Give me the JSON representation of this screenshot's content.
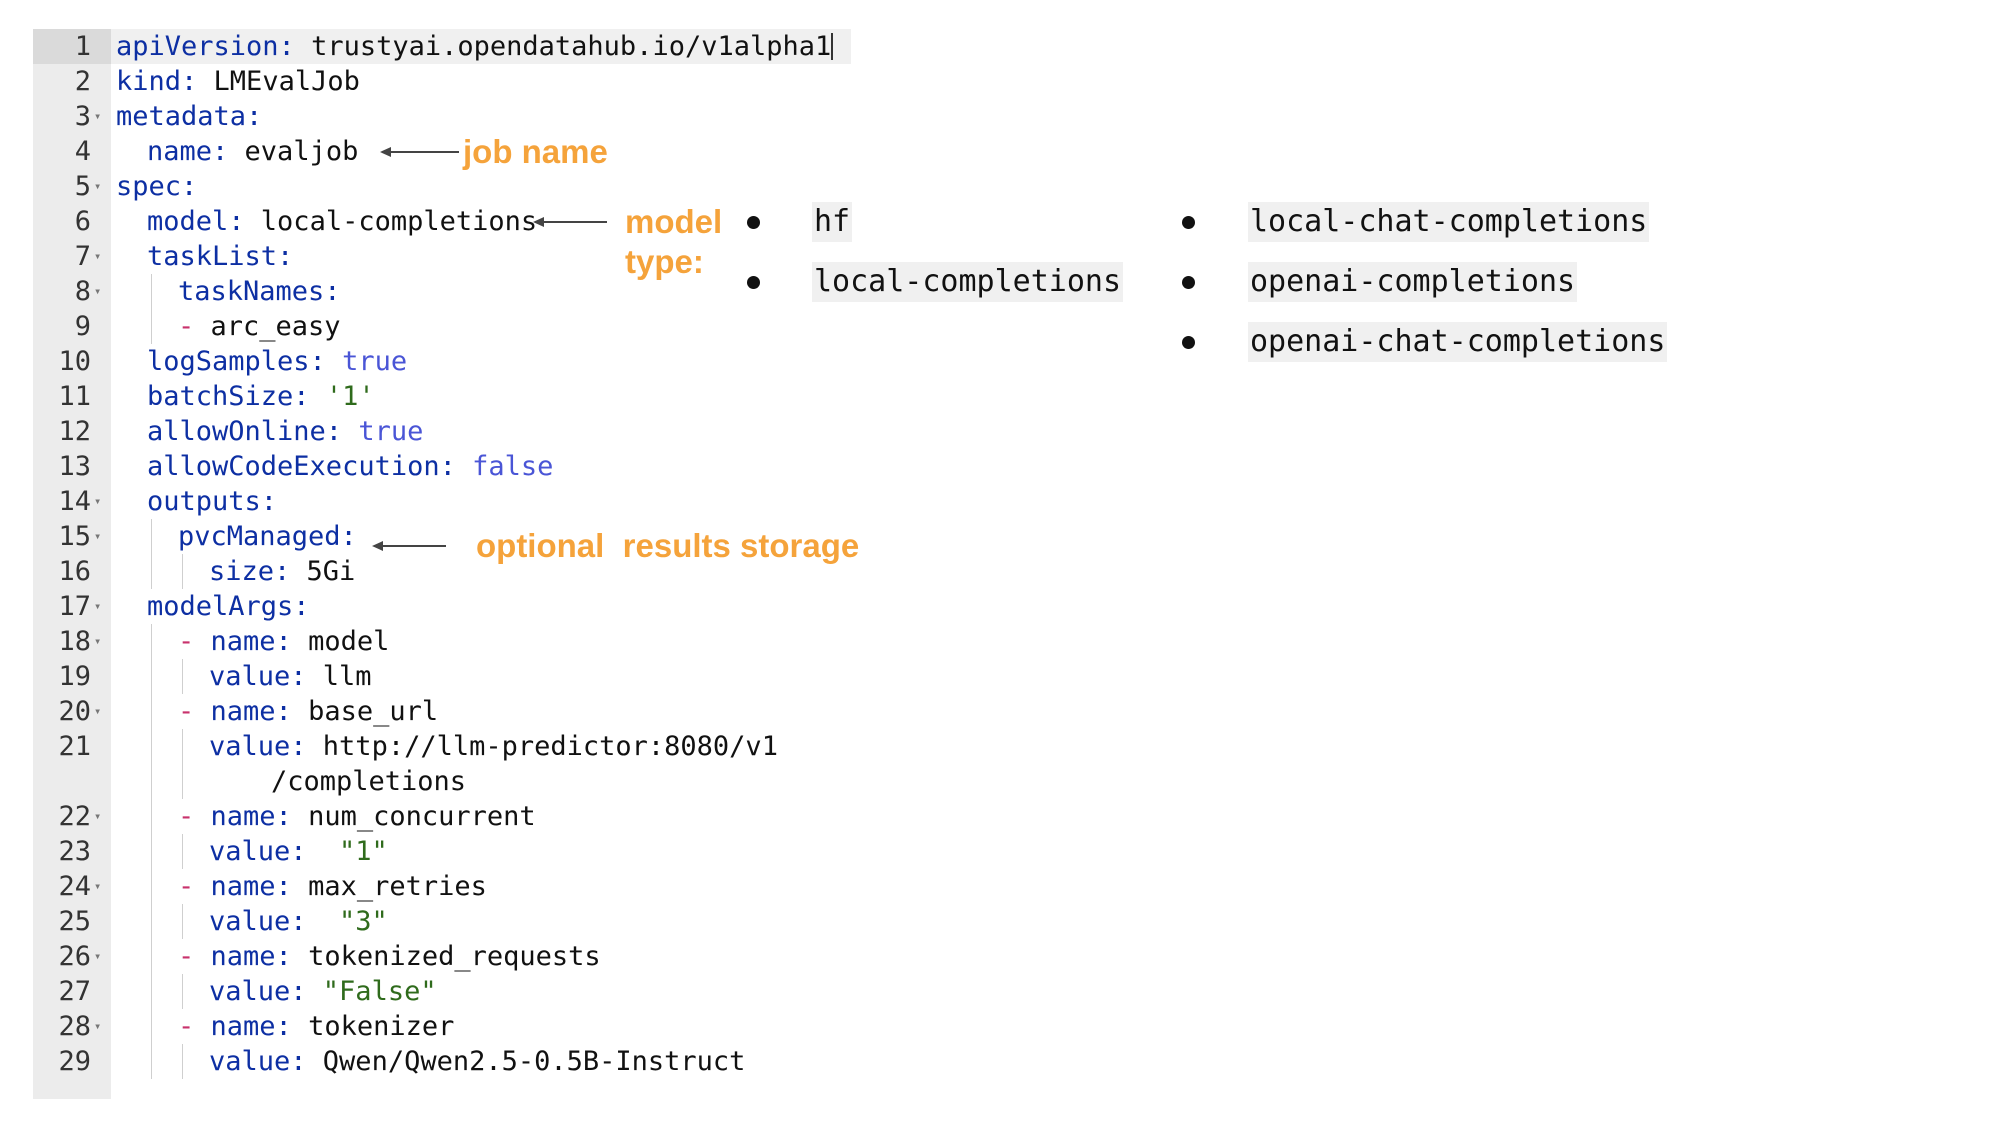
{
  "editor": {
    "lines": [
      {
        "n": "1",
        "fold": false,
        "indent": 0,
        "tokens": [
          [
            "k",
            "apiVersion: "
          ],
          [
            "v",
            "trustyai.opendatahub.io/v1alpha1"
          ]
        ]
      },
      {
        "n": "2",
        "fold": false,
        "indent": 0,
        "tokens": [
          [
            "k",
            "kind: "
          ],
          [
            "v",
            "LMEvalJob"
          ]
        ]
      },
      {
        "n": "3",
        "fold": true,
        "indent": 0,
        "tokens": [
          [
            "k",
            "metadata:"
          ]
        ]
      },
      {
        "n": "4",
        "fold": false,
        "indent": 1,
        "tokens": [
          [
            "k",
            "name: "
          ],
          [
            "v",
            "evaljob"
          ]
        ]
      },
      {
        "n": "5",
        "fold": true,
        "indent": 0,
        "tokens": [
          [
            "k",
            "spec:"
          ]
        ]
      },
      {
        "n": "6",
        "fold": false,
        "indent": 1,
        "tokens": [
          [
            "k",
            "model: "
          ],
          [
            "v",
            "local-completions"
          ]
        ]
      },
      {
        "n": "7",
        "fold": true,
        "indent": 1,
        "tokens": [
          [
            "k",
            "taskList:"
          ]
        ]
      },
      {
        "n": "8",
        "fold": true,
        "indent": 2,
        "tokens": [
          [
            "k",
            "taskNames:"
          ]
        ]
      },
      {
        "n": "9",
        "fold": false,
        "indent": 2,
        "tokens": [
          [
            "d",
            "- "
          ],
          [
            "v",
            "arc_easy"
          ]
        ]
      },
      {
        "n": "10",
        "fold": false,
        "indent": 1,
        "tokens": [
          [
            "k",
            "logSamples: "
          ],
          [
            "b",
            "true"
          ]
        ]
      },
      {
        "n": "11",
        "fold": false,
        "indent": 1,
        "tokens": [
          [
            "k",
            "batchSize: "
          ],
          [
            "s",
            "'1'"
          ]
        ]
      },
      {
        "n": "12",
        "fold": false,
        "indent": 1,
        "tokens": [
          [
            "k",
            "allowOnline: "
          ],
          [
            "b",
            "true"
          ]
        ]
      },
      {
        "n": "13",
        "fold": false,
        "indent": 1,
        "tokens": [
          [
            "k",
            "allowCodeExecution: "
          ],
          [
            "b",
            "false"
          ]
        ]
      },
      {
        "n": "14",
        "fold": true,
        "indent": 1,
        "tokens": [
          [
            "k",
            "outputs:"
          ]
        ]
      },
      {
        "n": "15",
        "fold": true,
        "indent": 2,
        "tokens": [
          [
            "k",
            "pvcManaged:"
          ]
        ]
      },
      {
        "n": "16",
        "fold": false,
        "indent": 3,
        "tokens": [
          [
            "k",
            "size: "
          ],
          [
            "v",
            "5Gi"
          ]
        ]
      },
      {
        "n": "17",
        "fold": true,
        "indent": 1,
        "tokens": [
          [
            "k",
            "modelArgs:"
          ]
        ]
      },
      {
        "n": "18",
        "fold": true,
        "indent": 2,
        "tokens": [
          [
            "d",
            "- "
          ],
          [
            "k",
            "name: "
          ],
          [
            "v",
            "model"
          ]
        ]
      },
      {
        "n": "19",
        "fold": false,
        "indent": 3,
        "tokens": [
          [
            "k",
            "value: "
          ],
          [
            "v",
            "llm"
          ]
        ]
      },
      {
        "n": "20",
        "fold": true,
        "indent": 2,
        "tokens": [
          [
            "d",
            "- "
          ],
          [
            "k",
            "name: "
          ],
          [
            "v",
            "base_url"
          ]
        ]
      },
      {
        "n": "21",
        "fold": false,
        "indent": 3,
        "tokens": [
          [
            "k",
            "value: "
          ],
          [
            "v",
            "http://llm-predictor:8080/v1"
          ]
        ]
      },
      {
        "n": "",
        "fold": false,
        "indent": 5,
        "tokens": [
          [
            "v",
            "/completions"
          ]
        ]
      },
      {
        "n": "22",
        "fold": true,
        "indent": 2,
        "tokens": [
          [
            "d",
            "- "
          ],
          [
            "k",
            "name: "
          ],
          [
            "v",
            "num_concurrent"
          ]
        ]
      },
      {
        "n": "23",
        "fold": false,
        "indent": 3,
        "tokens": [
          [
            "k",
            "value:  "
          ],
          [
            "s",
            "\"1\""
          ]
        ]
      },
      {
        "n": "24",
        "fold": true,
        "indent": 2,
        "tokens": [
          [
            "d",
            "- "
          ],
          [
            "k",
            "name: "
          ],
          [
            "v",
            "max_retries"
          ]
        ]
      },
      {
        "n": "25",
        "fold": false,
        "indent": 3,
        "tokens": [
          [
            "k",
            "value:  "
          ],
          [
            "s",
            "\"3\""
          ]
        ]
      },
      {
        "n": "26",
        "fold": true,
        "indent": 2,
        "tokens": [
          [
            "d",
            "- "
          ],
          [
            "k",
            "name: "
          ],
          [
            "v",
            "tokenized_requests"
          ]
        ]
      },
      {
        "n": "27",
        "fold": false,
        "indent": 3,
        "tokens": [
          [
            "k",
            "value: "
          ],
          [
            "s",
            "\"False\""
          ]
        ]
      },
      {
        "n": "28",
        "fold": true,
        "indent": 2,
        "tokens": [
          [
            "d",
            "- "
          ],
          [
            "k",
            "name: "
          ],
          [
            "v",
            "tokenizer"
          ]
        ]
      },
      {
        "n": "29",
        "fold": false,
        "indent": 3,
        "tokens": [
          [
            "k",
            "value: "
          ],
          [
            "v",
            "Qwen/Qwen2.5-0.5B-Instruct"
          ]
        ]
      }
    ]
  },
  "annotations": {
    "job_name": "job name",
    "model_type_1": "model",
    "model_type_2": "type:",
    "storage": "optional  results storage"
  },
  "model_types": {
    "col1": [
      "hf",
      "local-completions"
    ],
    "col2": [
      "local-chat-completions",
      "openai-completions",
      "openai-chat-completions"
    ]
  },
  "colors": {
    "accent": "#f5a33b",
    "key": "#0d2fa3",
    "boolean": "#4a55d6",
    "string": "#2f6b1c",
    "dash": "#c8326c"
  }
}
